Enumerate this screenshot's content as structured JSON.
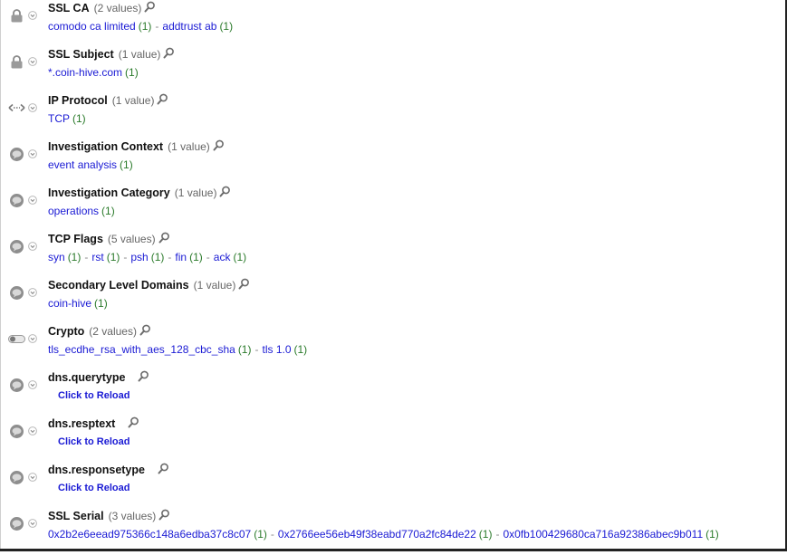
{
  "colors": {
    "link": "#1a1ad4",
    "count": "#2a7a2a",
    "label_muted": "#666666"
  },
  "reload_label": "Click to Reload",
  "fields": [
    {
      "name": "SSL CA",
      "count_label": "(2 values)",
      "icon": "lock-icon",
      "values": [
        {
          "text": "comodo ca limited",
          "count": "(1)"
        },
        {
          "text": "addtrust ab",
          "count": "(1)"
        }
      ]
    },
    {
      "name": "SSL Subject",
      "count_label": "(1 value)",
      "icon": "lock-icon",
      "values": [
        {
          "text": "*.coin-hive.com",
          "count": "(1)"
        }
      ]
    },
    {
      "name": "IP Protocol",
      "count_label": "(1 value)",
      "icon": "bidirectional-arrow-icon",
      "values": [
        {
          "text": "TCP",
          "count": "(1)"
        }
      ]
    },
    {
      "name": "Investigation Context",
      "count_label": "(1 value)",
      "icon": "speech-bubble-icon",
      "values": [
        {
          "text": "event analysis",
          "count": "(1)"
        }
      ]
    },
    {
      "name": "Investigation Category",
      "count_label": "(1 value)",
      "icon": "speech-bubble-icon",
      "values": [
        {
          "text": "operations",
          "count": "(1)"
        }
      ]
    },
    {
      "name": "TCP Flags",
      "count_label": "(5 values)",
      "icon": "speech-bubble-icon",
      "values": [
        {
          "text": "syn",
          "count": "(1)"
        },
        {
          "text": "rst",
          "count": "(1)"
        },
        {
          "text": "psh",
          "count": "(1)"
        },
        {
          "text": "fin",
          "count": "(1)"
        },
        {
          "text": "ack",
          "count": "(1)"
        }
      ]
    },
    {
      "name": "Secondary Level Domains",
      "count_label": "(1 value)",
      "icon": "speech-bubble-icon",
      "values": [
        {
          "text": "coin-hive",
          "count": "(1)"
        }
      ]
    },
    {
      "name": "Crypto",
      "count_label": "(2 values)",
      "icon": "toggle-icon",
      "values": [
        {
          "text": "tls_ecdhe_rsa_with_aes_128_cbc_sha",
          "count": "(1)"
        },
        {
          "text": "tls 1.0",
          "count": "(1)"
        }
      ]
    },
    {
      "name": "dns.querytype",
      "count_label": "",
      "icon": "speech-bubble-icon",
      "reload": true,
      "values": []
    },
    {
      "name": "dns.resptext",
      "count_label": "",
      "icon": "speech-bubble-icon",
      "reload": true,
      "values": []
    },
    {
      "name": "dns.responsetype",
      "count_label": "",
      "icon": "speech-bubble-icon",
      "reload": true,
      "values": []
    },
    {
      "name": "SSL Serial",
      "count_label": "(3 values)",
      "icon": "speech-bubble-icon",
      "values": [
        {
          "text": "0x2b2e6eead975366c148a6edba37c8c07",
          "count": "(1)"
        },
        {
          "text": "0x2766ee56eb49f38eabd770a2fc84de22",
          "count": "(1)"
        },
        {
          "text": "0x0fb100429680ca716a92386abec9b011",
          "count": "(1)"
        }
      ]
    }
  ]
}
